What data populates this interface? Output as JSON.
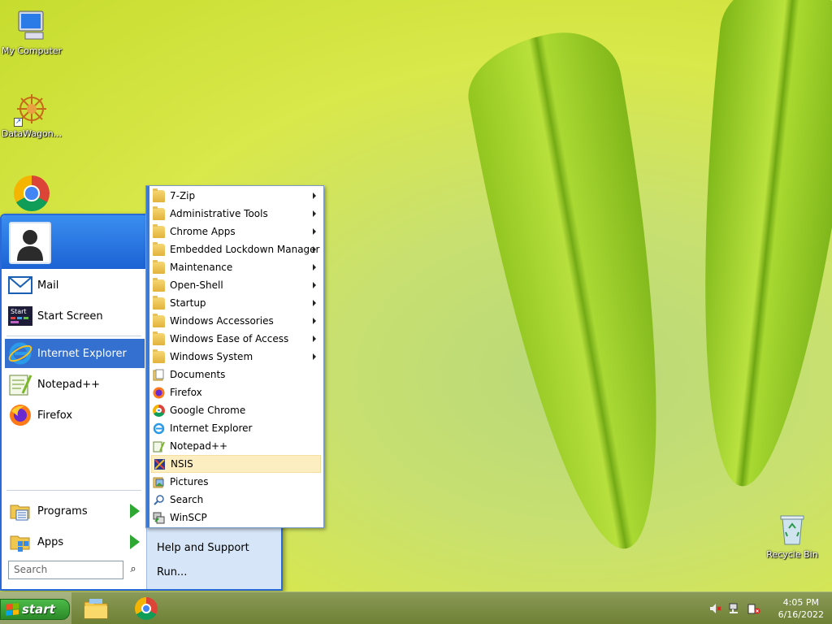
{
  "desktop": {
    "icons": [
      {
        "label": "My Computer"
      },
      {
        "label": "DataWagon..."
      },
      {
        "label": "Recycle Bin"
      }
    ]
  },
  "start_menu": {
    "pinned": [
      {
        "label": "Mail",
        "icon": "mail-icon"
      },
      {
        "label": "Start Screen",
        "icon": "start-screen-icon"
      }
    ],
    "recent": [
      {
        "label": "Internet Explorer",
        "icon": "internet-explorer-icon"
      },
      {
        "label": "Notepad++",
        "icon": "notepadpp-icon"
      },
      {
        "label": "Firefox",
        "icon": "firefox-icon"
      }
    ],
    "programs_label": "Programs",
    "apps_label": "Apps",
    "search_placeholder": "Search",
    "right": {
      "help_label": "Help and Support",
      "run_label": "Run..."
    }
  },
  "programs_submenu": {
    "items": [
      {
        "label": "7-Zip",
        "icon": "folder-icon",
        "has_submenu": true
      },
      {
        "label": "Administrative Tools",
        "icon": "folder-icon",
        "has_submenu": true
      },
      {
        "label": "Chrome Apps",
        "icon": "folder-icon",
        "has_submenu": true
      },
      {
        "label": "Embedded Lockdown Manager",
        "icon": "folder-icon",
        "has_submenu": true
      },
      {
        "label": "Maintenance",
        "icon": "folder-icon",
        "has_submenu": true
      },
      {
        "label": "Open-Shell",
        "icon": "folder-icon",
        "has_submenu": true
      },
      {
        "label": "Startup",
        "icon": "folder-icon",
        "has_submenu": true
      },
      {
        "label": "Windows Accessories",
        "icon": "folder-icon",
        "has_submenu": true
      },
      {
        "label": "Windows Ease of Access",
        "icon": "folder-icon",
        "has_submenu": true
      },
      {
        "label": "Windows System",
        "icon": "folder-icon",
        "has_submenu": true
      },
      {
        "label": "Documents",
        "icon": "documents-icon",
        "has_submenu": false
      },
      {
        "label": "Firefox",
        "icon": "firefox-icon",
        "has_submenu": false
      },
      {
        "label": "Google Chrome",
        "icon": "chrome-icon",
        "has_submenu": false
      },
      {
        "label": "Internet Explorer",
        "icon": "internet-explorer-icon",
        "has_submenu": false
      },
      {
        "label": "Notepad++",
        "icon": "notepadpp-icon",
        "has_submenu": false
      },
      {
        "label": "NSIS",
        "icon": "nsis-icon",
        "has_submenu": false,
        "hovered": true
      },
      {
        "label": "Pictures",
        "icon": "pictures-icon",
        "has_submenu": false
      },
      {
        "label": "Search",
        "icon": "search-icon",
        "has_submenu": false
      },
      {
        "label": "WinSCP",
        "icon": "winscp-icon",
        "has_submenu": false
      }
    ]
  },
  "taskbar": {
    "start_label": "start",
    "clock_time": "4:05 PM",
    "clock_date": "6/16/2022"
  },
  "colors": {
    "menu_blue": "#2a6ad8",
    "highlight": "#3470d0",
    "hover": "#fdeec2",
    "start_green": "#2c8a28"
  }
}
